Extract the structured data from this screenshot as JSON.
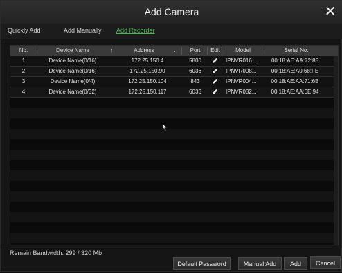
{
  "dialog": {
    "title": "Add Camera",
    "close_glyph": "✕"
  },
  "tabs": [
    {
      "label": "Quickly Add"
    },
    {
      "label": "Add Manually"
    },
    {
      "label": "Add Recorder"
    }
  ],
  "table": {
    "headers": {
      "no": "No.",
      "name": "Device Name",
      "sort_glyph": "↑",
      "address": "Address",
      "dropdown_glyph": "⌄",
      "port": "Port",
      "edit": "Edit",
      "model": "Model",
      "serial": "Serial No."
    },
    "rows": [
      {
        "no": "1",
        "name": "Device Name(0/16)",
        "address": "172.25.150.4",
        "port": "5800",
        "edit_icon": "pencil-icon",
        "model": "IPNVR016...",
        "serial": "00:18:AE:AA:72:85"
      },
      {
        "no": "2",
        "name": "Device Name(0/16)",
        "address": "172.25.150.90",
        "port": "6036",
        "edit_icon": "pencil-icon",
        "model": "IPNVR008...",
        "serial": "00:18:AE:A0:68:FE"
      },
      {
        "no": "3",
        "name": "Device Name(0/4)",
        "address": "172.25.150.104",
        "port": "843",
        "edit_icon": "pencil-icon",
        "model": "IPNVR004...",
        "serial": "00:18:AE:AA:71:6B"
      },
      {
        "no": "4",
        "name": "Device Name(0/32)",
        "address": "172.25.150.117",
        "port": "6036",
        "edit_icon": "pencil-icon",
        "model": "IPNVR032...",
        "serial": "00:18:AE:AA:6E:94"
      }
    ]
  },
  "footer": {
    "bandwidth": "Remain Bandwidth: 299 / 320 Mb",
    "buttons": {
      "default_password": "Default Password",
      "manual_add": "Manual Add",
      "add": "Add",
      "cancel": "Cancel"
    }
  },
  "colors": {
    "accent": "#43b84f",
    "header_bg": "#3a3a3a"
  }
}
